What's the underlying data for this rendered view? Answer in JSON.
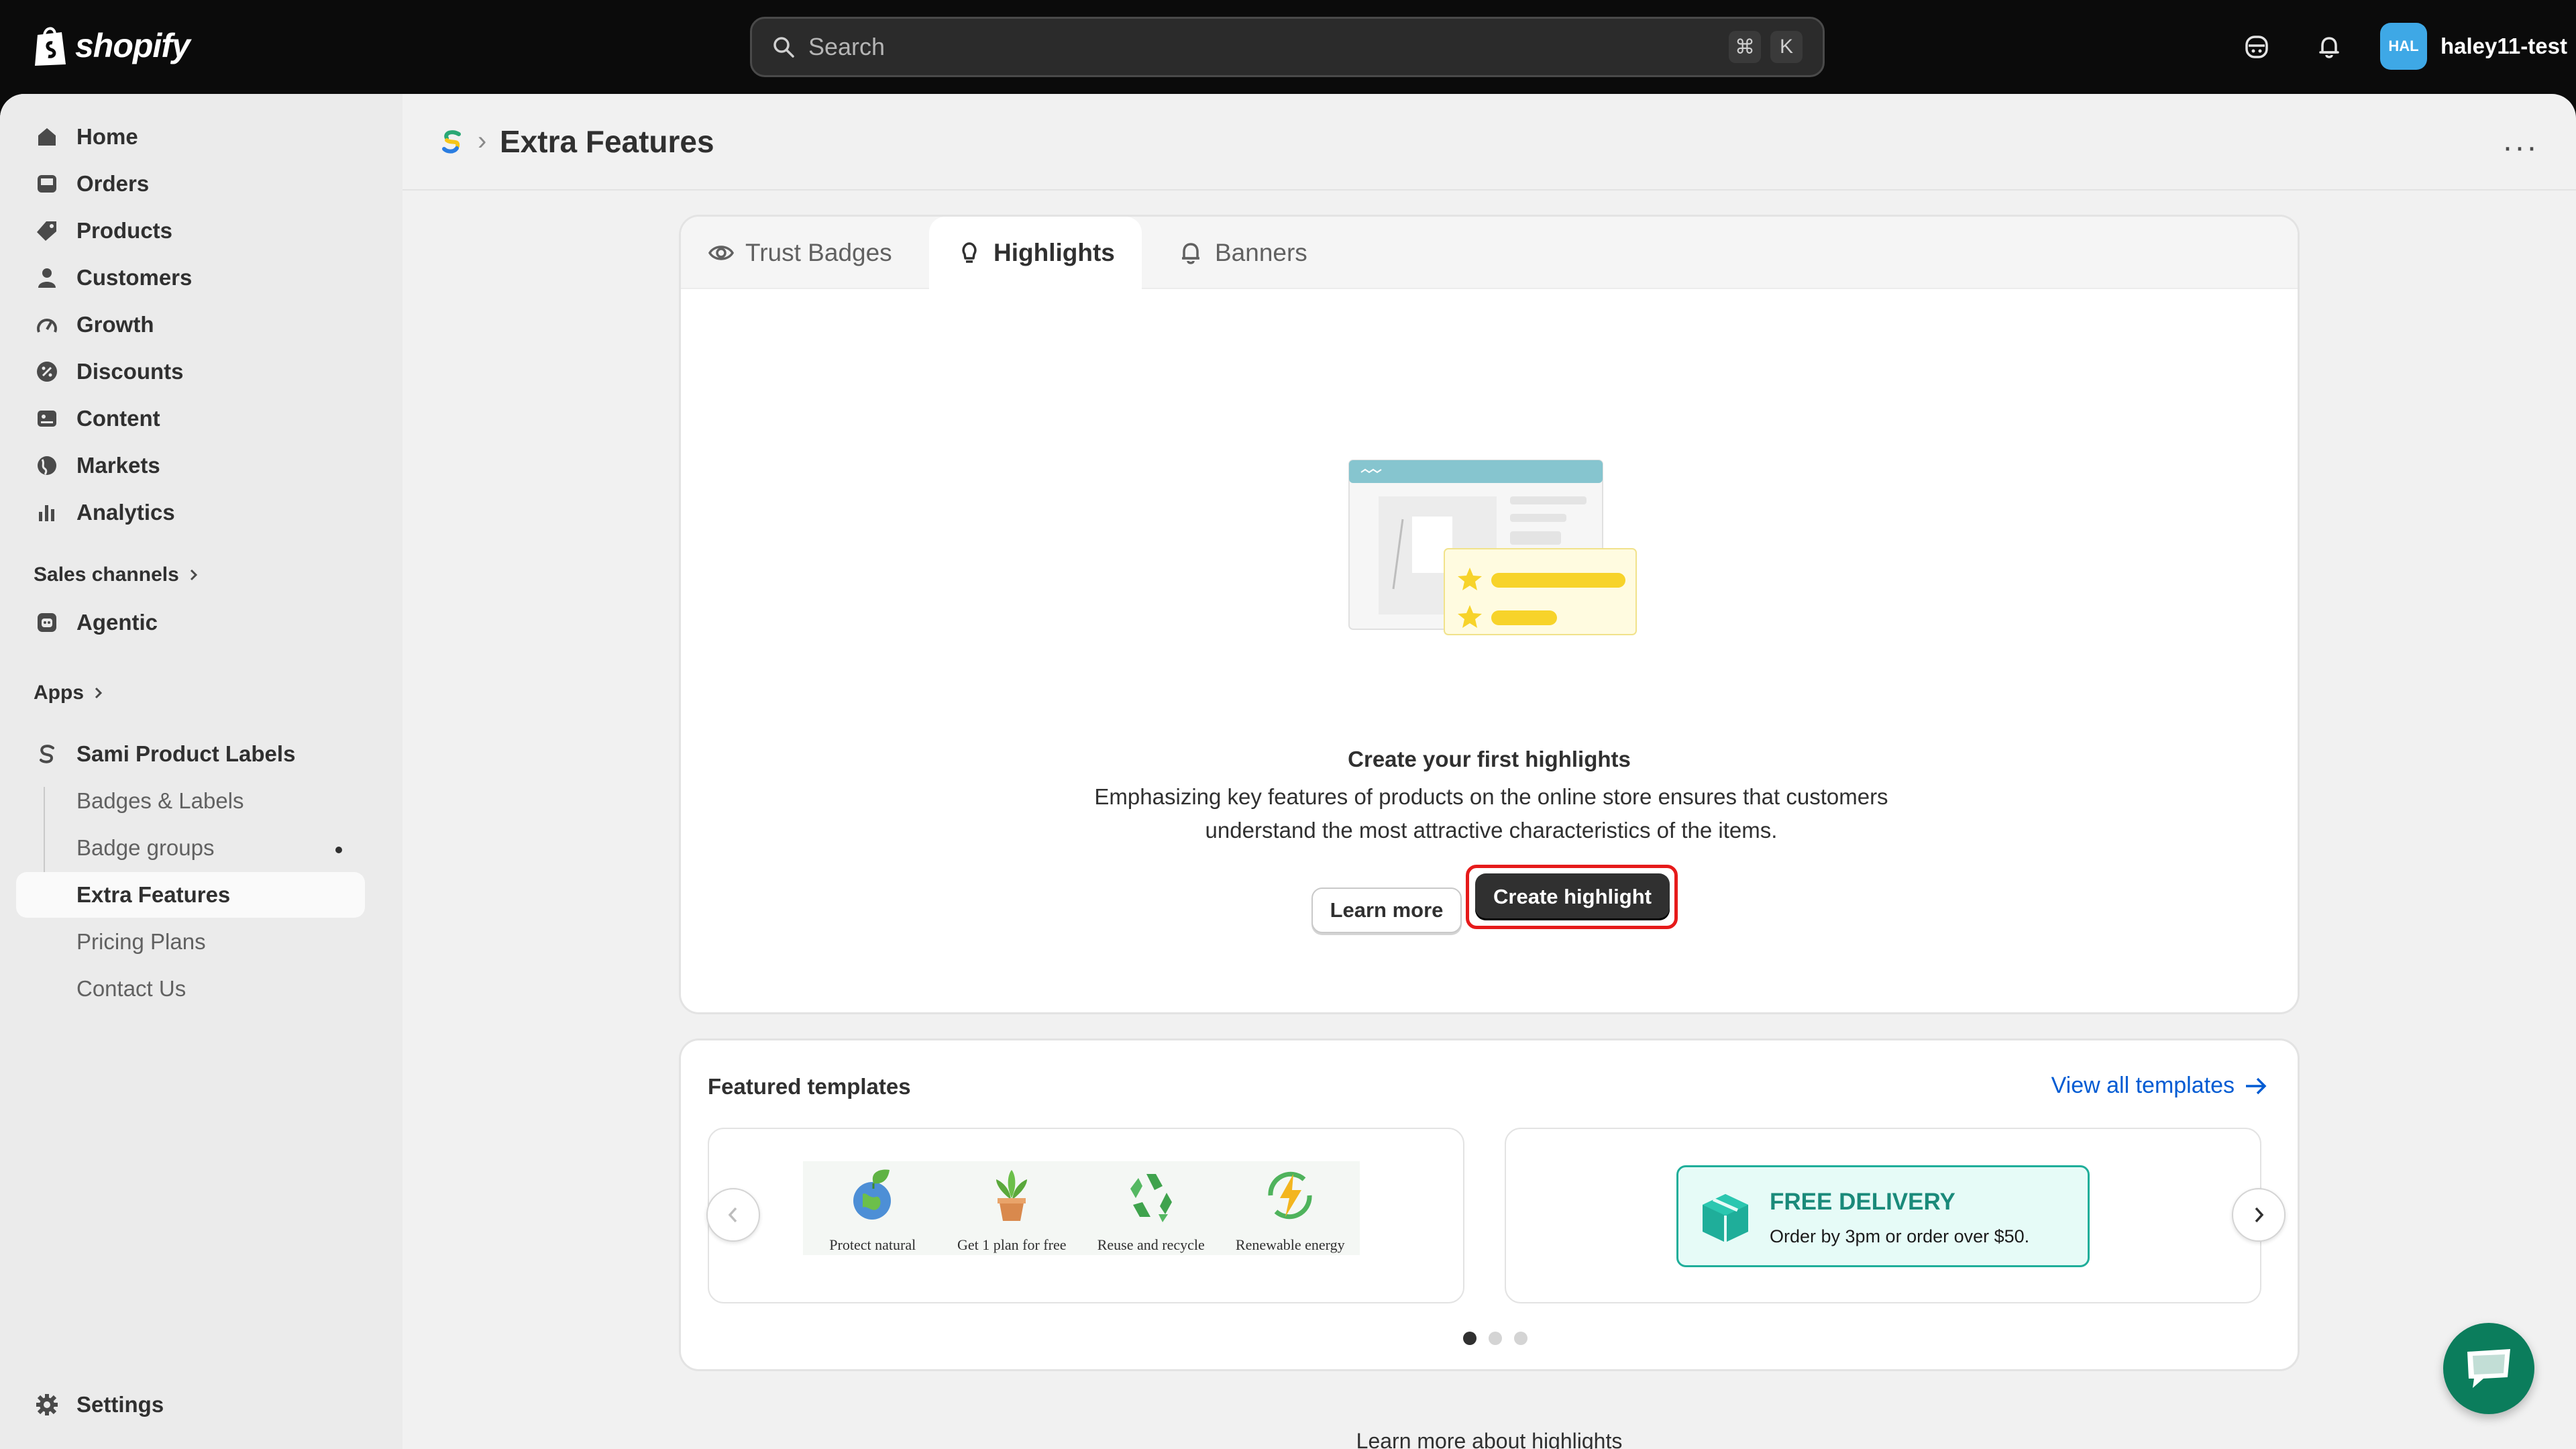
{
  "topbar": {
    "brand": "shopify",
    "search_placeholder": "Search",
    "shortcut_keys": [
      "⌘",
      "K"
    ],
    "user_initials": "HAL",
    "user_name": "haley11-test"
  },
  "sidebar": {
    "items": [
      {
        "label": "Home",
        "icon": "home-icon"
      },
      {
        "label": "Orders",
        "icon": "inbox-icon"
      },
      {
        "label": "Products",
        "icon": "tag-icon"
      },
      {
        "label": "Customers",
        "icon": "person-icon"
      },
      {
        "label": "Growth",
        "icon": "gauge-icon"
      },
      {
        "label": "Discounts",
        "icon": "discount-icon"
      },
      {
        "label": "Content",
        "icon": "content-icon"
      },
      {
        "label": "Markets",
        "icon": "globe-icon"
      },
      {
        "label": "Analytics",
        "icon": "bar-chart-icon"
      }
    ],
    "sales_channels_label": "Sales channels",
    "agentic_label": "Agentic",
    "apps_label": "Apps",
    "app_name": "Sami Product Labels",
    "app_subitems": [
      "Badges & Labels",
      "Badge groups",
      "Extra Features",
      "Pricing Plans",
      "Contact Us"
    ],
    "active_subitem": "Extra Features",
    "settings_label": "Settings"
  },
  "header": {
    "title": "Extra Features",
    "separator": "›",
    "more": "···"
  },
  "tabs": [
    {
      "label": "Trust Badges",
      "icon": "eye-icon",
      "active": false
    },
    {
      "label": "Highlights",
      "icon": "lightbulb-icon",
      "active": true
    },
    {
      "label": "Banners",
      "icon": "bell-icon",
      "active": false
    }
  ],
  "empty_state": {
    "title": "Create your first highlights",
    "description": "Emphasizing key features of products on the online store ensures that customers understand the most attractive characteristics of the items.",
    "learn_more": "Learn more",
    "create": "Create highlight"
  },
  "featured": {
    "title": "Featured templates",
    "view_all": "View all templates",
    "template_1_items": [
      "Protect natural",
      "Get 1 plan for free",
      "Reuse and recycle",
      "Renewable energy"
    ],
    "template_2_title": "FREE DELIVERY",
    "template_2_subtitle": "Order by 3pm or order over $50.",
    "active_page": 1,
    "page_count": 3
  },
  "footer_link": "Learn more about highlights",
  "colors": {
    "accent_link": "#005bd3",
    "primary_button": "#303030",
    "highlight_outline": "#e61a1a",
    "delivery_green": "#1fae9a",
    "chat_green": "#0b7d5c"
  }
}
